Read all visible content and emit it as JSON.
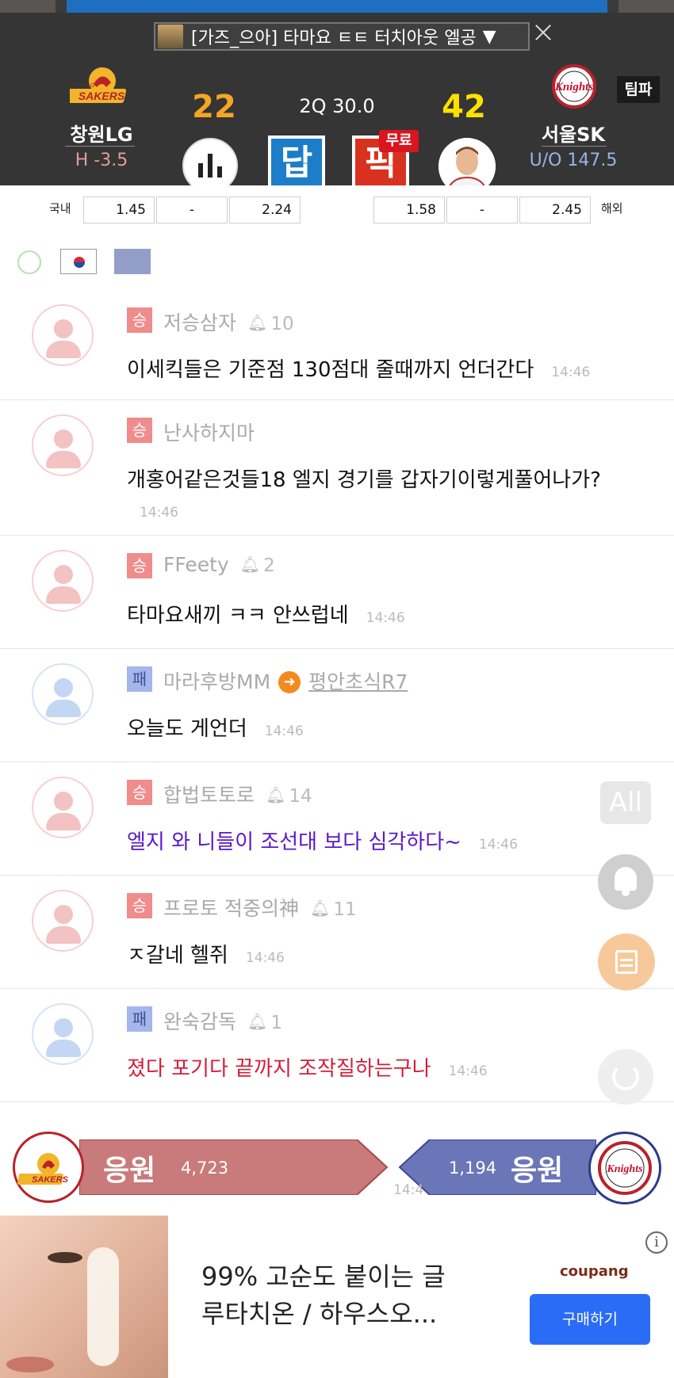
{
  "ticker": {
    "text": "[가즈_으아] 타마요 ㅌㅌ 터치아웃 엘공",
    "arrow": "▼"
  },
  "home": {
    "logo_text_small": "LG",
    "logo_text": "SAKERS",
    "name": "창원LG",
    "line": "H -3.5",
    "score": "22",
    "color": "#b8222a"
  },
  "away": {
    "logo_text": "Knights",
    "name": "서울SK",
    "line": "U/O 147.5",
    "score": "42",
    "color": "#2b3a8c"
  },
  "quarter": "2Q  30.0",
  "team_button": "팀파",
  "actions": {
    "answer": "답",
    "pick": "픽",
    "free_badge": "무료"
  },
  "odds": {
    "domestic_label": "국내",
    "domestic": [
      "1.45",
      "-",
      "2.24"
    ],
    "overseas": [
      "1.58",
      "-",
      "2.45"
    ],
    "overseas_label": "해외"
  },
  "chat": [
    {
      "result": "승",
      "type": "win",
      "nick": "저승삼자",
      "bell_count": "10",
      "text": "이세킥들은 기준점 130점대 줄때까지 언더간다",
      "time": "14:46",
      "style": ""
    },
    {
      "result": "승",
      "type": "win",
      "nick": "난사하지마",
      "bell_count": "",
      "text": "개홍어같은것들18 엘지 경기를 갑자기이렇게풀어나가?",
      "time": "14:46",
      "style": ""
    },
    {
      "result": "승",
      "type": "win",
      "nick": "FFeety",
      "bell_count": "2",
      "text": "타마요새끼 ㅋㅋ 안쓰럽네",
      "time": "14:46",
      "style": ""
    },
    {
      "result": "패",
      "type": "lose",
      "nick": "마라후방MM",
      "target": "평안초식R7",
      "text": "오늘도 게언더",
      "time": "14:46",
      "style": ""
    },
    {
      "result": "승",
      "type": "win",
      "nick": "합법토토로",
      "bell_count": "14",
      "text": "엘지 와 니들이 조선대 보다 심각하다~",
      "time": "14:46",
      "style": "purple"
    },
    {
      "result": "승",
      "type": "win",
      "nick": "프로토 적중의神",
      "bell_count": "11",
      "text": "ㅈ갈네 헬쥐",
      "time": "14:46",
      "style": ""
    },
    {
      "result": "패",
      "type": "lose",
      "nick": "완숙감독",
      "bell_count": "1",
      "text": "졌다 포기다 끝까지 조작질하는구나",
      "time": "14:46",
      "style": "red"
    }
  ],
  "floating": {
    "all_label": "All"
  },
  "support": {
    "home_label": "응원",
    "home_count": "4,723",
    "away_label": "응원",
    "away_count": "1,194",
    "home_color": "#c97a7a",
    "away_color": "#6b76b8",
    "time_fragment": "14:4"
  },
  "ad": {
    "text_line1": "99% 고순도 붙이는 글",
    "text_line2": "루타치온 / 하우스오...",
    "brand": "coupang",
    "button": "구매하기",
    "info": "i"
  }
}
